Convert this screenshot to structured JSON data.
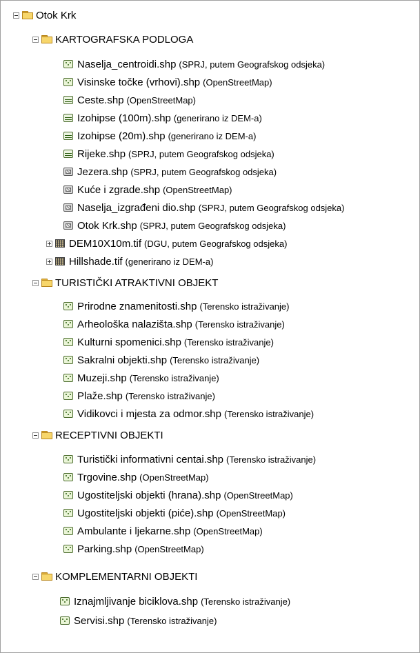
{
  "tree": {
    "root": {
      "label": "Otok Krk"
    },
    "groups": [
      {
        "label": "KARTOGRAFSKA PODLOGA",
        "layers": [
          {
            "name": "Naselja_centroidi.shp",
            "source": "(SPRJ, putem Geografskog odsjeka)",
            "icon": "point"
          },
          {
            "name": "Visinske točke (vrhovi).shp",
            "source": "(OpenStreetMap)",
            "icon": "point"
          },
          {
            "name": "Ceste.shp",
            "source": "(OpenStreetMap)",
            "icon": "line"
          },
          {
            "name": "Izohipse (100m).shp",
            "source": "(generirano iz DEM-a)",
            "icon": "line"
          },
          {
            "name": "Izohipse (20m).shp",
            "source": "(generirano iz DEM-a)",
            "icon": "line"
          },
          {
            "name": "Rijeke.shp",
            "source": "(SPRJ, putem Geografskog odsjeka)",
            "icon": "line"
          },
          {
            "name": "Jezera.shp",
            "source": "(SPRJ, putem Geografskog odsjeka)",
            "icon": "polygon"
          },
          {
            "name": "Kuće i zgrade.shp",
            "source": "(OpenStreetMap)",
            "icon": "polygon"
          },
          {
            "name": "Naselja_izgrađeni dio.shp",
            "source": "(SPRJ, putem Geografskog odsjeka)",
            "icon": "polygon"
          },
          {
            "name": "Otok Krk.shp",
            "source": "(SPRJ, putem Geografskog odsjeka)",
            "icon": "polygon"
          },
          {
            "name": "DEM10X10m.tif",
            "source": "(DGU, putem Geografskog odsjeka)",
            "icon": "raster",
            "expander": "plus"
          },
          {
            "name": "Hillshade.tif",
            "source": "(generirano iz DEM-a)",
            "icon": "raster",
            "expander": "plus"
          }
        ]
      },
      {
        "label": "TURISTIČKI ATRAKTIVNI OBJEKT",
        "layers": [
          {
            "name": "Prirodne znamenitosti.shp",
            "source": "(Terensko istraživanje)",
            "icon": "point"
          },
          {
            "name": "Arheološka nalazišta.shp",
            "source": "(Terensko istraživanje)",
            "icon": "point"
          },
          {
            "name": "Kulturni spomenici.shp",
            "source": "(Terensko istraživanje)",
            "icon": "point"
          },
          {
            "name": "Sakralni objekti.shp",
            "source": "(Terensko istraživanje)",
            "icon": "point"
          },
          {
            "name": "Muzeji.shp",
            "source": "(Terensko istraživanje)",
            "icon": "point"
          },
          {
            "name": "Plaže.shp",
            "source": "(Terensko istraživanje)",
            "icon": "point"
          },
          {
            "name": "Vidikovci i mjesta za odmor.shp",
            "source": "(Terensko istraživanje)",
            "icon": "point"
          }
        ]
      },
      {
        "label": "RECEPTIVNI OBJEKTI",
        "layers": [
          {
            "name": "Turistički informativni centai.shp",
            "source": "(Terensko istraživanje)",
            "icon": "point"
          },
          {
            "name": "Trgovine.shp",
            "source": "(OpenStreetMap)",
            "icon": "point"
          },
          {
            "name": "Ugostiteljski objekti (hrana).shp",
            "source": "(OpenStreetMap)",
            "icon": "point"
          },
          {
            "name": "Ugostiteljski objekti (piće).shp",
            "source": "(OpenStreetMap)",
            "icon": "point"
          },
          {
            "name": "Ambulante i ljekarne.shp",
            "source": "(OpenStreetMap)",
            "icon": "point"
          },
          {
            "name": "Parking.shp",
            "source": "(OpenStreetMap)",
            "icon": "point"
          }
        ]
      },
      {
        "label": "KOMPLEMENTARNI OBJEKTI",
        "layers": [
          {
            "name": "Iznajmljivanje biciklova.shp",
            "source": "(Terensko istraživanje)",
            "icon": "point"
          },
          {
            "name": "Servisi.shp",
            "source": "(Terensko istraživanje)",
            "icon": "point"
          }
        ]
      }
    ]
  }
}
